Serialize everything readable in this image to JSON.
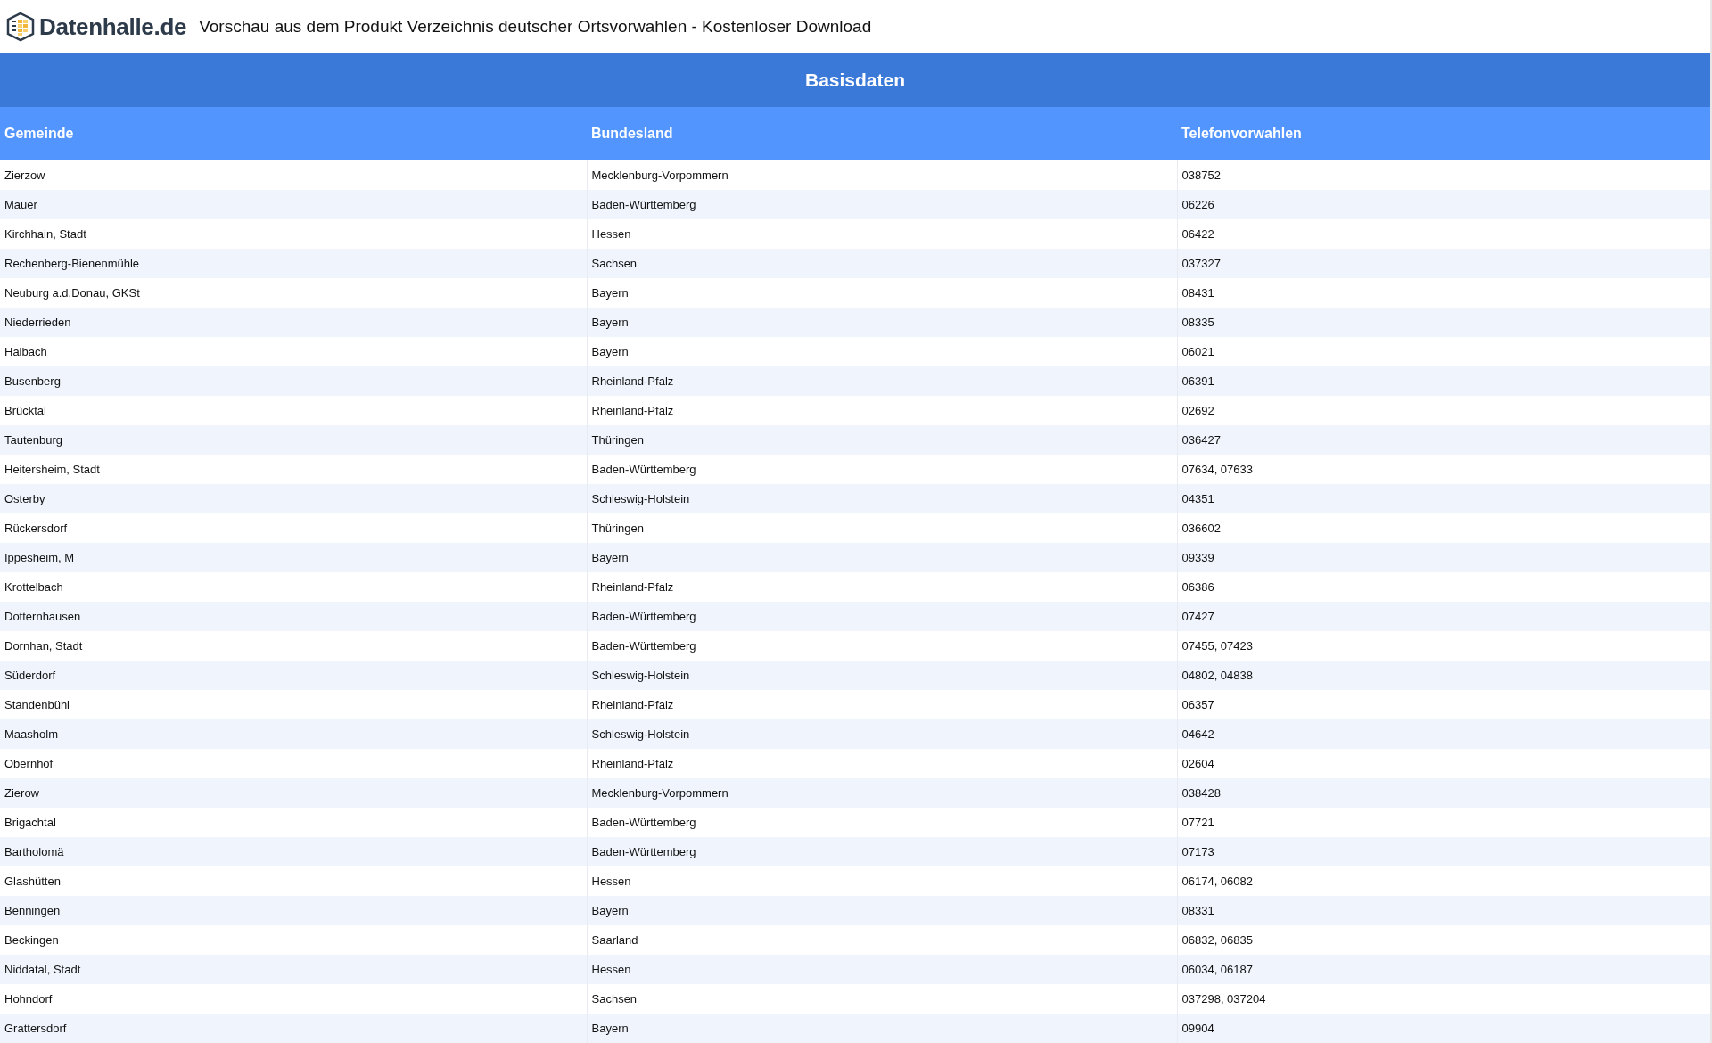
{
  "header": {
    "logo": "Datenhalle.de",
    "title": "Vorschau aus dem Produkt Verzeichnis deutscher Ortsvorwahlen - Kostenloser Download"
  },
  "table": {
    "caption": "Basisdaten",
    "columns": [
      "Gemeinde",
      "Bundesland",
      "Telefonvorwahlen"
    ],
    "rows": [
      [
        "Zierzow",
        "Mecklenburg-Vorpommern",
        "038752"
      ],
      [
        "Mauer",
        "Baden-Württemberg",
        "06226"
      ],
      [
        "Kirchhain, Stadt",
        "Hessen",
        "06422"
      ],
      [
        "Rechenberg-Bienenmühle",
        "Sachsen",
        "037327"
      ],
      [
        "Neuburg a.d.Donau, GKSt",
        "Bayern",
        "08431"
      ],
      [
        "Niederrieden",
        "Bayern",
        "08335"
      ],
      [
        "Haibach",
        "Bayern",
        "06021"
      ],
      [
        "Busenberg",
        "Rheinland-Pfalz",
        "06391"
      ],
      [
        "Brücktal",
        "Rheinland-Pfalz",
        "02692"
      ],
      [
        "Tautenburg",
        "Thüringen",
        "036427"
      ],
      [
        "Heitersheim, Stadt",
        "Baden-Württemberg",
        "07634, 07633"
      ],
      [
        "Osterby",
        "Schleswig-Holstein",
        "04351"
      ],
      [
        "Rückersdorf",
        "Thüringen",
        "036602"
      ],
      [
        "Ippesheim, M",
        "Bayern",
        "09339"
      ],
      [
        "Krottelbach",
        "Rheinland-Pfalz",
        "06386"
      ],
      [
        "Dotternhausen",
        "Baden-Württemberg",
        "07427"
      ],
      [
        "Dornhan, Stadt",
        "Baden-Württemberg",
        "07455, 07423"
      ],
      [
        "Süderdorf",
        "Schleswig-Holstein",
        "04802, 04838"
      ],
      [
        "Standenbühl",
        "Rheinland-Pfalz",
        "06357"
      ],
      [
        "Maasholm",
        "Schleswig-Holstein",
        "04642"
      ],
      [
        "Obernhof",
        "Rheinland-Pfalz",
        "02604"
      ],
      [
        "Zierow",
        "Mecklenburg-Vorpommern",
        "038428"
      ],
      [
        "Brigachtal",
        "Baden-Württemberg",
        "07721"
      ],
      [
        "Bartholomä",
        "Baden-Württemberg",
        "07173"
      ],
      [
        "Glashütten",
        "Hessen",
        "06174, 06082"
      ],
      [
        "Benningen",
        "Bayern",
        "08331"
      ],
      [
        "Beckingen",
        "Saarland",
        "06832, 06835"
      ],
      [
        "Niddatal, Stadt",
        "Hessen",
        "06034, 06187"
      ],
      [
        "Hohndorf",
        "Sachsen",
        "037298, 037204"
      ],
      [
        "Grattersdorf",
        "Bayern",
        "09904"
      ]
    ]
  }
}
